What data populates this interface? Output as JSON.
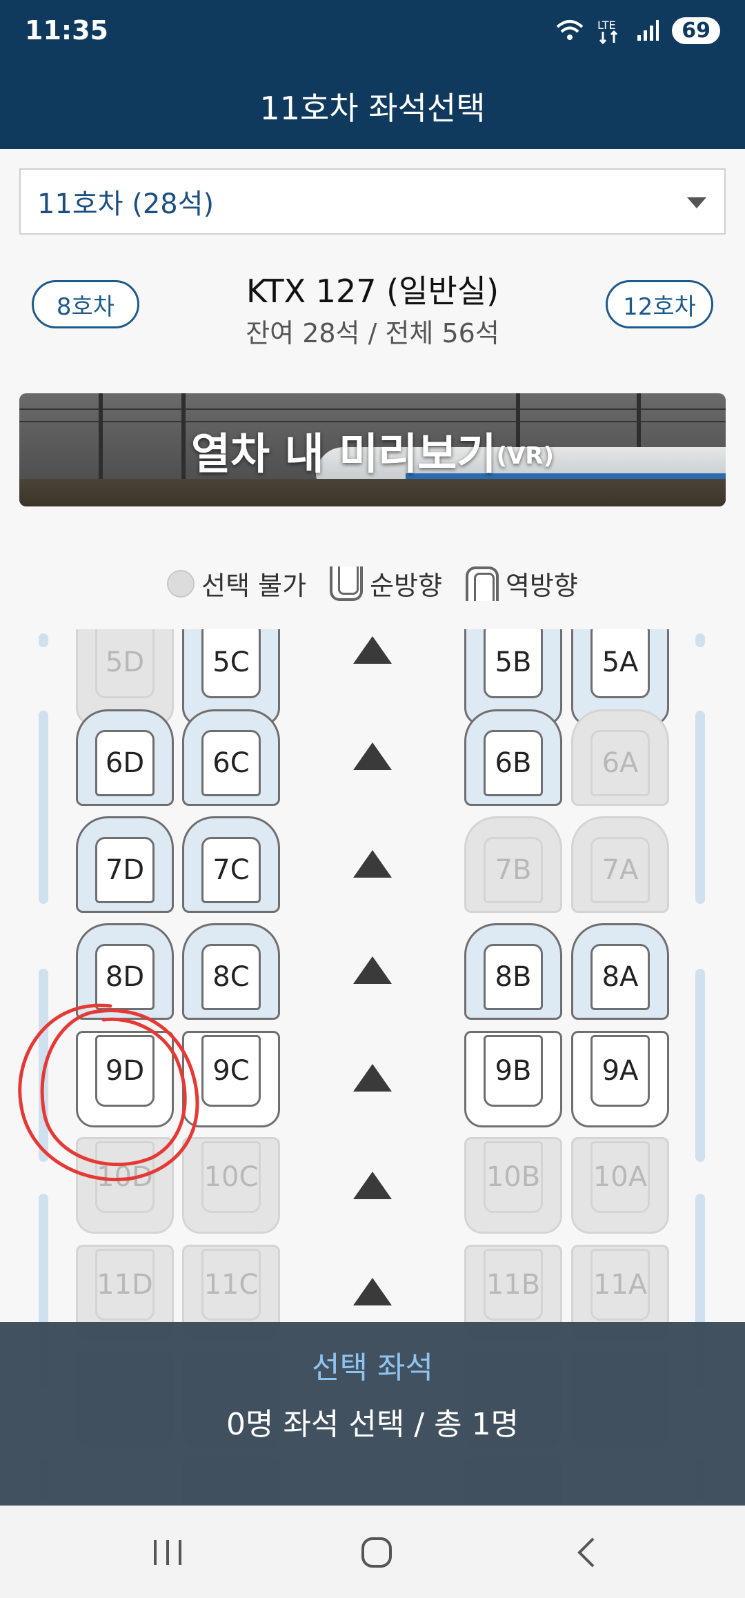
{
  "status": {
    "time": "11:35",
    "battery": "69"
  },
  "appbar": {
    "title": "11호차 좌석선택"
  },
  "car_select": {
    "value": "11호차 (28석)"
  },
  "train": {
    "prev_car": "8호차",
    "next_car": "12호차",
    "name": "KTX 127 (일반실)",
    "availability": "잔여 28석 / 전체 56석"
  },
  "vr_banner": {
    "label": "열차 내 미리보기",
    "suffix": "(VR)"
  },
  "legend": {
    "unavailable": "선택 불가",
    "forward": "순방향",
    "backward": "역방향"
  },
  "seats": {
    "row5": [
      "5D",
      "5C",
      "5B",
      "5A"
    ],
    "row6": [
      "6D",
      "6C",
      "6B",
      "6A"
    ],
    "row7": [
      "7D",
      "7C",
      "7B",
      "7A"
    ],
    "row8": [
      "8D",
      "8C",
      "8B",
      "8A"
    ],
    "row9": [
      "9D",
      "9C",
      "9B",
      "9A"
    ],
    "row10": [
      "10D",
      "10C",
      "10B",
      "10A"
    ],
    "row11": [
      "11D",
      "11C",
      "11B",
      "11A"
    ]
  },
  "selection": {
    "title": "선택 좌석",
    "summary": "0명 좌석 선택 / 총 1명"
  },
  "colors": {
    "header": "#0f3a5e",
    "accent": "#1d5a8a",
    "seat_fill": "#dde9f3",
    "annotation": "#e53935"
  }
}
